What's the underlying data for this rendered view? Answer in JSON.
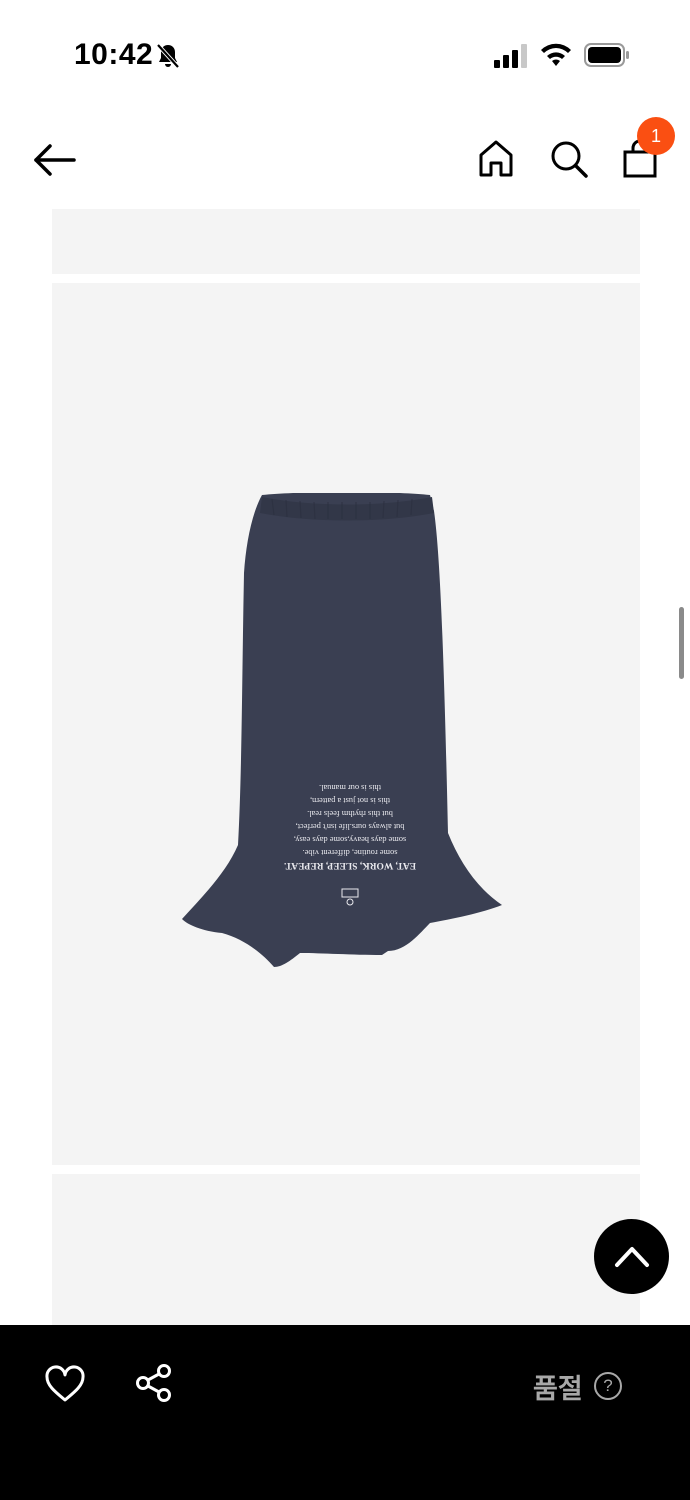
{
  "status_bar": {
    "time": "10:42",
    "icons": [
      "bell-off-icon",
      "signal-icon",
      "wifi-icon",
      "battery-icon"
    ]
  },
  "header": {
    "icons": [
      "back-arrow-icon",
      "home-icon",
      "search-icon",
      "shopping-bag-icon"
    ],
    "cart_count": "1"
  },
  "product": {
    "print_lines": [
      "EAT, WORK, SLEEP, REPEAT.",
      "some routine, different vibe.",
      "some days heavy,some days easy,",
      "but always ours.life isn't perfect,",
      "but this rhythm feels real.",
      "this is not just a pattern,",
      "this is our manual."
    ]
  },
  "bottom_bar": {
    "soldout_label": "품절",
    "help_symbol": "?",
    "icons": [
      "heart-icon",
      "share-icon",
      "help-icon"
    ]
  },
  "colors": {
    "badge": "#fa4f12",
    "bottom_bar": "#000000",
    "image_background": "#f4f4f4",
    "skirt": "#3a3f52",
    "soldout_text": "#a8a8a8"
  }
}
